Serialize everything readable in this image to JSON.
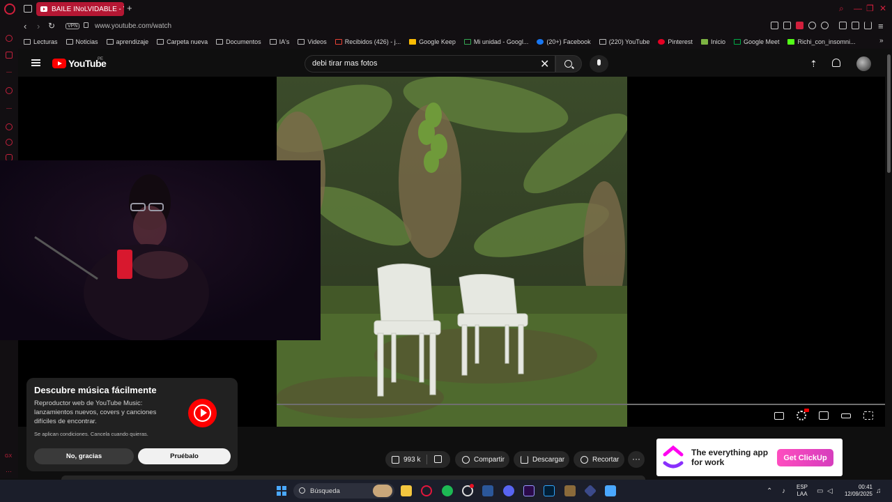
{
  "browser": {
    "tab_title": "BAILE INoLVIDABLE - You",
    "new_tab_glyph": "+",
    "url": "www.youtube.com/watch",
    "vpn_label": "VPN",
    "accent_color": "#d11f3c",
    "bookmarks": [
      {
        "label": "Lecturas",
        "icon": "folder-icon"
      },
      {
        "label": "Noticias",
        "icon": "folder-icon"
      },
      {
        "label": "aprendizaje",
        "icon": "folder-icon"
      },
      {
        "label": "Carpeta nueva",
        "icon": "folder-icon"
      },
      {
        "label": "Documentos",
        "icon": "folder-icon"
      },
      {
        "label": "IA's",
        "icon": "folder-icon"
      },
      {
        "label": "Videos",
        "icon": "folder-icon"
      },
      {
        "label": "Recibidos (426) - j...",
        "icon": "gmail-icon"
      },
      {
        "label": "Google Keep",
        "icon": "keep-icon"
      },
      {
        "label": "Mi unidad - Googl...",
        "icon": "drive-icon"
      },
      {
        "label": "(20+) Facebook",
        "icon": "facebook-icon"
      },
      {
        "label": "(220) YouTube",
        "icon": "page-icon"
      },
      {
        "label": "Pinterest",
        "icon": "pinterest-icon"
      },
      {
        "label": "Inicio",
        "icon": "inicio-icon"
      },
      {
        "label": "Google Meet",
        "icon": "meet-icon"
      },
      {
        "label": "Richi_con_insomni...",
        "icon": "kick-icon"
      }
    ]
  },
  "youtube": {
    "logo_text": "YouTube",
    "country_code": "PE",
    "search_query": "debi tirar mas fotos",
    "brand_color": "#ff0000"
  },
  "actions": {
    "likes": "993 k",
    "share": "Compartir",
    "download": "Descargar",
    "clip": "Recortar",
    "more": "···"
  },
  "ad": {
    "text": "The everything app for work",
    "cta": "Get ClickUp"
  },
  "music_popup": {
    "title": "Descubre música fácilmente",
    "body": "Reproductor web de YouTube Music: lanzamientos nuevos, covers y canciones difíciles de encontrar.",
    "terms": "Se aplican condiciones. Cancela cuando quieras.",
    "dismiss": "No, gracias",
    "try": "Pruébalo"
  },
  "taskbar": {
    "search_placeholder": "Búsqueda",
    "lang_line1": "ESP",
    "lang_line2": "LAA",
    "time": "00:41",
    "date": "12/09/2025"
  }
}
